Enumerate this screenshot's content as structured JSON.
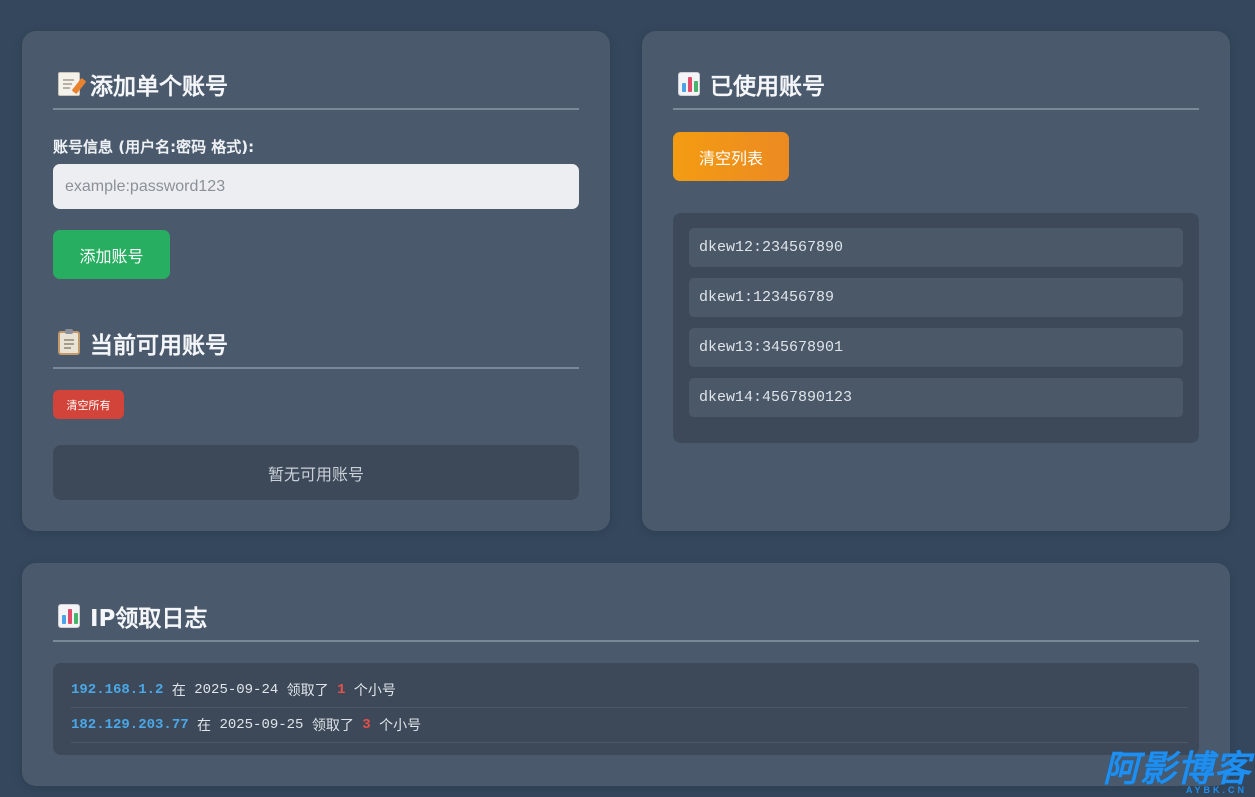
{
  "add_card": {
    "title": "添加单个账号",
    "field_label": "账号信息 (用户名:密码 格式):",
    "input_value": "",
    "input_placeholder": "example:password123",
    "add_button": "添加账号"
  },
  "available_card": {
    "title": "当前可用账号",
    "clear_all_button": "清空所有",
    "empty_text": "暂无可用账号"
  },
  "used_card": {
    "title": "已使用账号",
    "clear_list_button": "清空列表",
    "accounts": [
      "dkew12:234567890",
      "dkew1:123456789",
      "dkew13:345678901",
      "dkew14:4567890123"
    ]
  },
  "log_card": {
    "title": "IP领取日志",
    "entries": [
      {
        "ip": "192.168.1.2",
        "in_word": "在",
        "date": "2025-09-24",
        "took_word": "领取了",
        "count": "1",
        "suffix": "个小号"
      },
      {
        "ip": "182.129.203.77",
        "in_word": "在",
        "date": "2025-09-25",
        "took_word": "领取了",
        "count": "3",
        "suffix": "个小号"
      }
    ]
  },
  "icons": {
    "add_title_icon": "document-pencil-icon",
    "available_title_icon": "clipboard-icon",
    "used_title_icon": "bar-chart-icon",
    "log_title_icon": "bar-chart-icon"
  },
  "watermark": {
    "main": "阿影博客",
    "sub": "AYBK.CN"
  },
  "colors": {
    "background": "#34475c",
    "card": "#4a5a6c",
    "green_button": "#27ae60",
    "red_button": "#d2443a",
    "orange_button": "#f39c12",
    "ip_blue": "#4aa8e8",
    "count_red": "#e8504a"
  }
}
